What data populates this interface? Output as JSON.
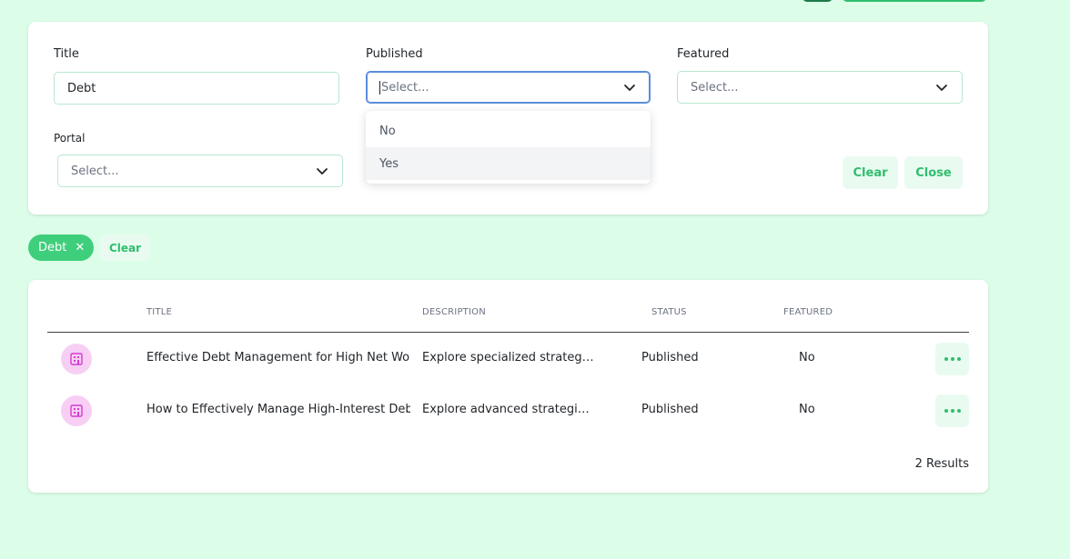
{
  "filters": {
    "title": {
      "label": "Title",
      "value": "Debt"
    },
    "published": {
      "label": "Published",
      "placeholder": "Select...",
      "options": [
        "No",
        "Yes"
      ]
    },
    "featured": {
      "label": "Featured",
      "placeholder": "Select..."
    },
    "portal": {
      "label": "Portal",
      "placeholder": "Select..."
    },
    "clear_label": "Clear",
    "close_label": "Close"
  },
  "active_filters": {
    "chip_label": "Debt",
    "chip_remove": "✕",
    "clear_label": "Clear"
  },
  "table": {
    "columns": [
      "TITLE",
      "DESCRIPTION",
      "STATUS",
      "FEATURED"
    ],
    "rows": [
      {
        "title": "Effective Debt Management for High Net Worth Individuals",
        "description": "Explore specialized strategies for managing debt",
        "status": "Published",
        "featured": "No",
        "icon": "building-icon"
      },
      {
        "title": "How to Effectively Manage High-Interest Debts",
        "description": "Explore advanced strategies for reducing debt",
        "status": "Published",
        "featured": "No",
        "icon": "building-icon"
      }
    ],
    "results_count": "2 Results"
  },
  "colors": {
    "accent": "#2fbe6e",
    "background": "#dcfee8",
    "avatar_bg": "#f7cff4",
    "avatar_icon": "#d63ad1"
  }
}
